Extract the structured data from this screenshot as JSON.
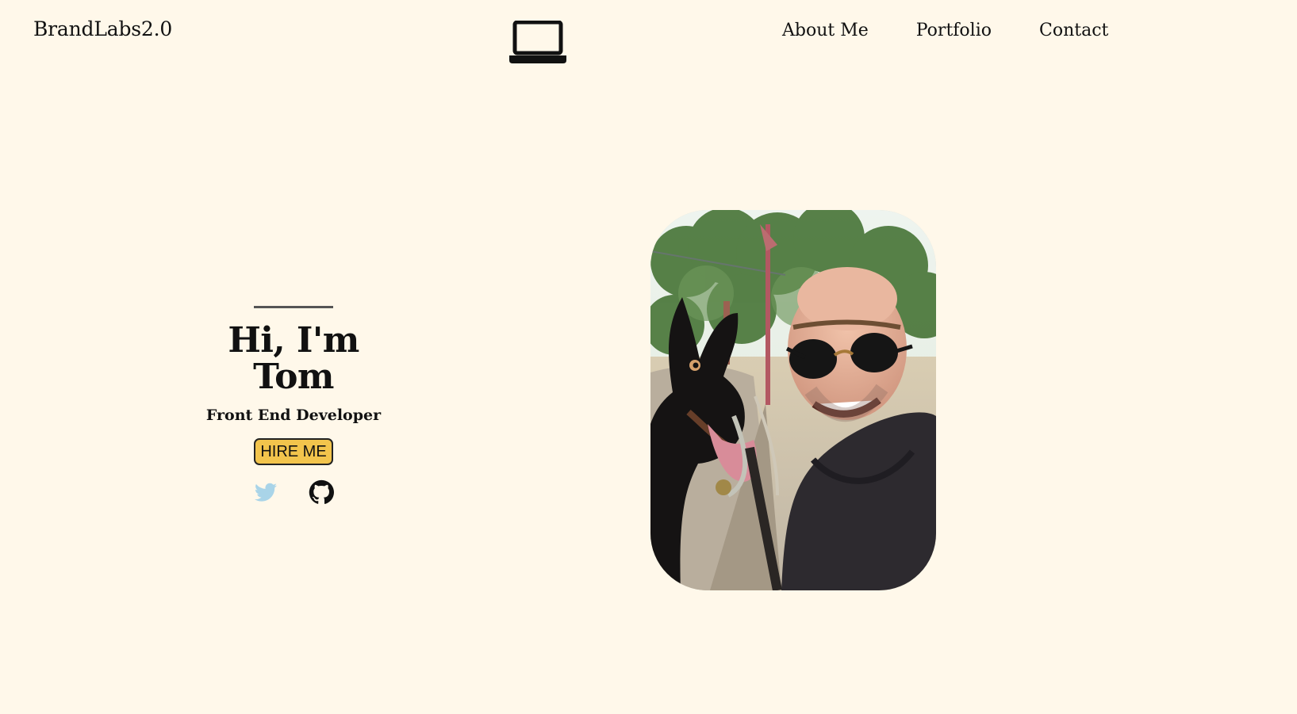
{
  "brand": {
    "title": "BrandLabs2.0"
  },
  "header": {
    "center_icon": "laptop-icon"
  },
  "nav": {
    "items": [
      {
        "label": "About Me"
      },
      {
        "label": "Portfolio"
      },
      {
        "label": "Contact"
      }
    ]
  },
  "hero": {
    "title": "Hi, I'm Tom",
    "subtitle": "Front End Developer",
    "button_label": "HIRE ME"
  },
  "socials": {
    "twitter_icon": "twitter-icon",
    "github_icon": "github-icon"
  },
  "colors": {
    "background": "#fff8ea",
    "accent": "#f2c44c",
    "text": "#111111",
    "twitter": "#a9d4e8"
  }
}
